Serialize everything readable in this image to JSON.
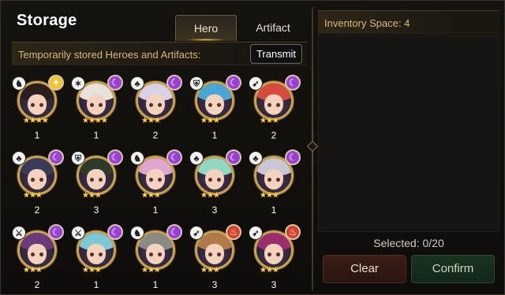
{
  "header": {
    "title": "Storage"
  },
  "tabs": [
    {
      "label": "Hero",
      "active": true
    },
    {
      "label": "Artifact",
      "active": false
    }
  ],
  "subheader": {
    "text": "Temporarily stored Heroes and Artifacts:",
    "transmit_label": "Transmit"
  },
  "heroes": [
    {
      "count": "1",
      "stars": "★★★★",
      "class_icon": "thief-class-icon",
      "class_glyph": "♞",
      "element_icon": "light-element-icon",
      "element_glyph": "✦",
      "element_color": "#f2c230",
      "hair": "#2a1e1e",
      "row": 0,
      "col": 0
    },
    {
      "count": "1",
      "stars": "★★★★",
      "class_icon": "mage-class-icon",
      "class_glyph": "✶",
      "element_icon": "dark-element-icon",
      "element_glyph": "☾",
      "element_color": "#9b3fd6",
      "hair": "#e8e2dc",
      "row": 0,
      "col": 1
    },
    {
      "count": "2",
      "stars": "★★★",
      "class_icon": "soul-weaver-class-icon",
      "class_glyph": "♣",
      "element_icon": "dark-element-icon",
      "element_glyph": "☾",
      "element_color": "#9b3fd6",
      "hair": "#d9cfe6",
      "row": 0,
      "col": 2
    },
    {
      "count": "1",
      "stars": "★★★",
      "class_icon": "knight-class-icon",
      "class_glyph": "⛨",
      "element_icon": "dark-element-icon",
      "element_glyph": "☾",
      "element_color": "#9b3fd6",
      "hair": "#4aa6d6",
      "row": 0,
      "col": 3
    },
    {
      "count": "2",
      "stars": "★★★",
      "class_icon": "ranger-class-icon",
      "class_glyph": "➶",
      "element_icon": "dark-element-icon",
      "element_glyph": "☾",
      "element_color": "#9b3fd6",
      "hair": "#d84a3e",
      "row": 0,
      "col": 4
    },
    {
      "count": "2",
      "stars": "★★★",
      "class_icon": "soul-weaver-class-icon",
      "class_glyph": "♣",
      "element_icon": "dark-element-icon",
      "element_glyph": "☾",
      "element_color": "#9b3fd6",
      "hair": "#3a3a5a",
      "row": 1,
      "col": 0
    },
    {
      "count": "3",
      "stars": "★★★",
      "class_icon": "knight-class-icon",
      "class_glyph": "⛨",
      "element_icon": "dark-element-icon",
      "element_glyph": "☾",
      "element_color": "#9b3fd6",
      "hair": "#2e3a2a",
      "row": 1,
      "col": 1
    },
    {
      "count": "1",
      "stars": "★★★",
      "class_icon": "thief-class-icon",
      "class_glyph": "♞",
      "element_icon": "dark-element-icon",
      "element_glyph": "☾",
      "element_color": "#9b3fd6",
      "hair": "#e0a6cf",
      "row": 1,
      "col": 2
    },
    {
      "count": "3",
      "stars": "★★★",
      "class_icon": "soul-weaver-class-icon",
      "class_glyph": "♣",
      "element_icon": "dark-element-icon",
      "element_glyph": "☾",
      "element_color": "#9b3fd6",
      "hair": "#8fd8c6",
      "row": 1,
      "col": 3
    },
    {
      "count": "1",
      "stars": "★★★",
      "class_icon": "soul-weaver-class-icon",
      "class_glyph": "♣",
      "element_icon": "dark-element-icon",
      "element_glyph": "☾",
      "element_color": "#9b3fd6",
      "hair": "#c9c6d6",
      "row": 1,
      "col": 4
    },
    {
      "count": "2",
      "stars": "★★★",
      "class_icon": "warrior-class-icon",
      "class_glyph": "⚔",
      "element_icon": "dark-element-icon",
      "element_glyph": "☾",
      "element_color": "#9b3fd6",
      "hair": "#6a3a7a",
      "row": 2,
      "col": 0
    },
    {
      "count": "1",
      "stars": "★★★",
      "class_icon": "warrior-class-icon",
      "class_glyph": "⚔",
      "element_icon": "dark-element-icon",
      "element_glyph": "☾",
      "element_color": "#9b3fd6",
      "hair": "#7ac8d8",
      "row": 2,
      "col": 1
    },
    {
      "count": "1",
      "stars": "★★★",
      "class_icon": "thief-class-icon",
      "class_glyph": "♞",
      "element_icon": "dark-element-icon",
      "element_glyph": "☾",
      "element_color": "#9b3fd6",
      "hair": "#8a8a86",
      "row": 2,
      "col": 2
    },
    {
      "count": "3",
      "stars": "★★★",
      "class_icon": "ranger-class-icon",
      "class_glyph": "➶",
      "element_icon": "fire-element-icon",
      "element_glyph": "♨",
      "element_color": "#d8402a",
      "hair": "#b07a48",
      "row": 2,
      "col": 3
    },
    {
      "count": "3",
      "stars": "★★★",
      "class_icon": "ranger-class-icon",
      "class_glyph": "➶",
      "element_icon": "fire-element-icon",
      "element_glyph": "♨",
      "element_color": "#d8402a",
      "hair": "#9a2e6e",
      "row": 2,
      "col": 4
    }
  ],
  "inventory": {
    "label": "Inventory Space: 4"
  },
  "footer": {
    "selected": "Selected: 0/20",
    "clear_label": "Clear",
    "confirm_label": "Confirm"
  }
}
